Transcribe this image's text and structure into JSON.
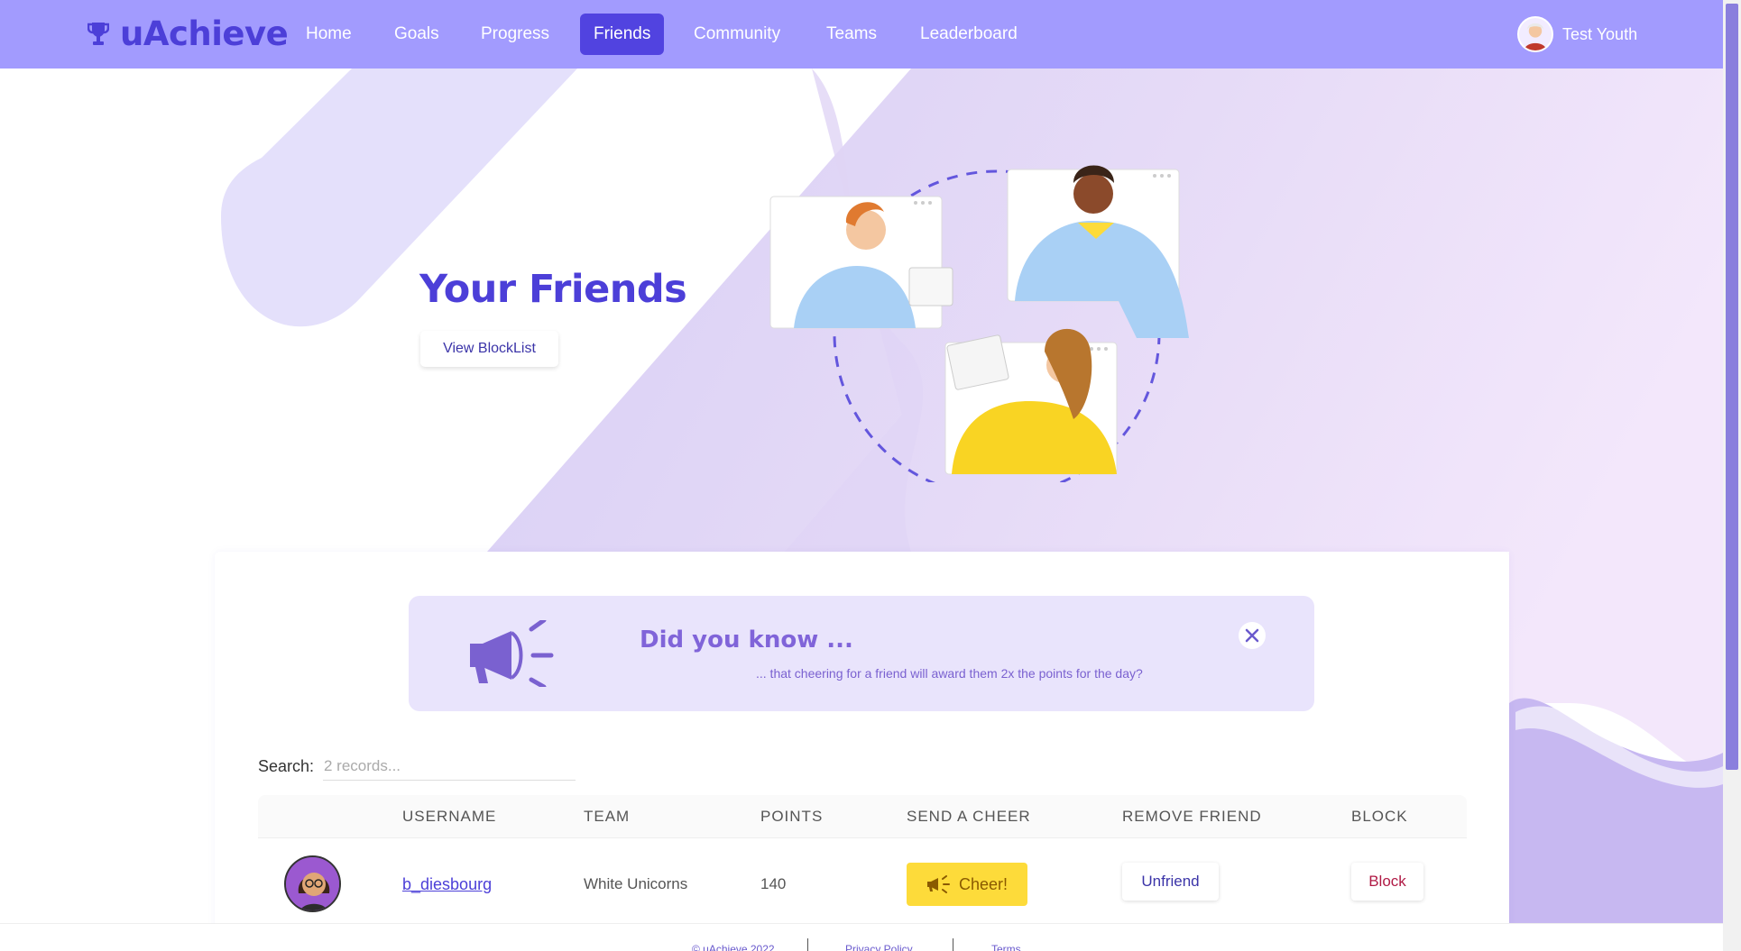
{
  "brand": {
    "name": "uAchieve",
    "icon": "trophy-icon"
  },
  "nav": {
    "items": [
      {
        "label": "Home",
        "active": false
      },
      {
        "label": "Goals",
        "active": false
      },
      {
        "label": "Progress",
        "active": false
      },
      {
        "label": "Friends",
        "active": true
      },
      {
        "label": "Community",
        "active": false
      },
      {
        "label": "Teams",
        "active": false
      },
      {
        "label": "Leaderboard",
        "active": false
      }
    ],
    "user": {
      "name": "Test Youth",
      "avatar": "user-avatar-icon"
    }
  },
  "hero": {
    "title": "Your Friends",
    "blocklist_button": "View BlockList"
  },
  "tip": {
    "title": "Did you know ...",
    "text": "... that cheering for a friend will award them 2x the points for the day?",
    "icon": "megaphone-icon",
    "close_icon": "close-icon"
  },
  "search": {
    "label": "Search:",
    "placeholder": "2 records..."
  },
  "table": {
    "headers": [
      "USERNAME",
      "TEAM",
      "POINTS",
      "SEND A CHEER",
      "REMOVE FRIEND",
      "BLOCK"
    ],
    "rows": [
      {
        "username": "b_diesbourg",
        "team": "White Unicorns",
        "points": "140",
        "cheer": "Cheer!",
        "unfriend": "Unfriend",
        "block": "Block"
      }
    ]
  },
  "footer": {
    "copyright": "© uAchieve 2022",
    "privacy": "Privacy Policy",
    "terms": "Terms"
  },
  "colors": {
    "navbar": "#a29bfe",
    "accent": "#4c3fd8",
    "active_nav": "#5143e0",
    "tip_bg": "#e9e4fc",
    "cheer": "#fddb3a",
    "block": "#b01a45"
  }
}
